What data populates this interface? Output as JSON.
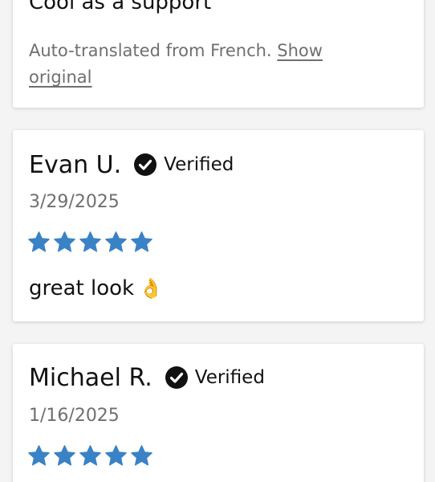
{
  "theme": {
    "star_color": "#3a82c6",
    "text_color": "#111111",
    "muted_color": "#6f6f6f"
  },
  "reviews": [
    {
      "body": "Cool as a support",
      "translation_note": "Auto-translated from French.",
      "show_original_label": "Show original"
    },
    {
      "reviewer": "Evan U.",
      "verified_label": "Verified",
      "date": "3/29/2025",
      "rating": 5,
      "body": "great look",
      "emoji": "👌"
    },
    {
      "reviewer": "Michael R.",
      "verified_label": "Verified",
      "date": "1/16/2025",
      "rating": 5
    }
  ]
}
